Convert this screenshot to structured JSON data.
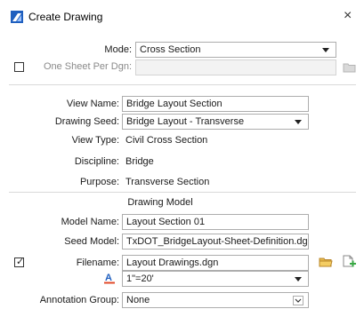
{
  "window": {
    "title": "Create Drawing",
    "close_symbol": "×",
    "app_icon": "bentley-openroads-icon"
  },
  "mode": {
    "label": "Mode:",
    "value": "Cross Section"
  },
  "one_sheet": {
    "label": "One Sheet Per Dgn:",
    "checked": false,
    "value": "",
    "icon": "folder-icon"
  },
  "view_name": {
    "label": "View Name:",
    "value": "Bridge Layout Section"
  },
  "drawing_seed": {
    "label": "Drawing Seed:",
    "value": "Bridge Layout - Transverse"
  },
  "view_type": {
    "label": "View Type:",
    "value": "Civil Cross Section"
  },
  "discipline": {
    "label": "Discipline:",
    "value": "Bridge"
  },
  "purpose": {
    "label": "Purpose:",
    "value": "Transverse Section"
  },
  "drawing_model": {
    "section_title": "Drawing Model",
    "model_name": {
      "label": "Model Name:",
      "value": "Layout Section 01"
    },
    "seed_model": {
      "label": "Seed Model:",
      "value": "TxDOT_BridgeLayout-Sheet-Definition.dgnlib"
    },
    "filename": {
      "label": "Filename:",
      "value": "Layout Drawings.dgn",
      "checked": true,
      "browse_icon": "folder-icon",
      "new_icon": "new-file-plus-icon"
    },
    "annotation_scale": {
      "icon": "annotation-scale-icon",
      "value": "1\"=20'"
    },
    "annotation_group": {
      "label": "Annotation Group:",
      "value": "None"
    }
  },
  "colors": {
    "folder": "#e8b94a",
    "new_plus": "#3aa845",
    "accent_blue": "#1f5fbf"
  }
}
